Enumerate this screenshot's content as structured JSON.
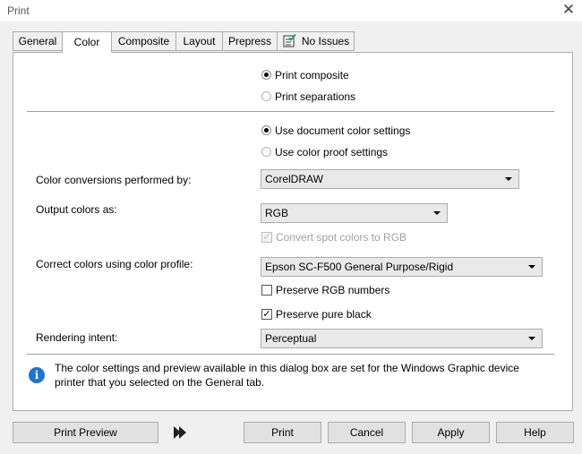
{
  "window": {
    "title": "Print",
    "close_glyph": "✕"
  },
  "tabs": [
    {
      "label": "General",
      "active": false
    },
    {
      "label": "Color",
      "active": true
    },
    {
      "label": "Composite",
      "active": false
    },
    {
      "label": "Layout",
      "active": false
    },
    {
      "label": "Prepress",
      "active": false
    },
    {
      "label": "No Issues",
      "active": false,
      "icon": "preflight-check-icon"
    }
  ],
  "color": {
    "output_mode": {
      "composite": {
        "label": "Print composite",
        "selected": true
      },
      "separations": {
        "label": "Print separations",
        "selected": false
      }
    },
    "color_source": {
      "document": {
        "label": "Use document color settings",
        "selected": true
      },
      "proof": {
        "label": "Use color proof settings",
        "selected": false
      }
    },
    "conversions": {
      "label": "Color conversions performed by:",
      "value": "CorelDRAW"
    },
    "output_colors": {
      "label": "Output colors as:",
      "value": "RGB"
    },
    "convert_spot": {
      "label": "Convert spot colors to RGB",
      "checked": true,
      "disabled": true
    },
    "profile": {
      "label": "Correct colors using color profile:",
      "value": "Epson SC-F500 General Purpose/Rigid"
    },
    "preserve_rgb": {
      "label": "Preserve RGB numbers",
      "checked": false
    },
    "preserve_black": {
      "label": "Preserve pure black",
      "checked": true
    },
    "intent": {
      "label": "Rendering intent:",
      "value": "Perceptual"
    },
    "info": {
      "line1": "The color settings and preview available in this dialog box are set for the Windows Graphic device",
      "line2": "printer that you selected on the General tab."
    }
  },
  "buttons": {
    "print_preview": "Print Preview",
    "print": "Print",
    "cancel": "Cancel",
    "apply": "Apply",
    "help": "Help"
  },
  "colors": {
    "info_icon": "#1e73d3",
    "panel": "#ffffff",
    "dialog_bg": "#f0f0f0"
  }
}
